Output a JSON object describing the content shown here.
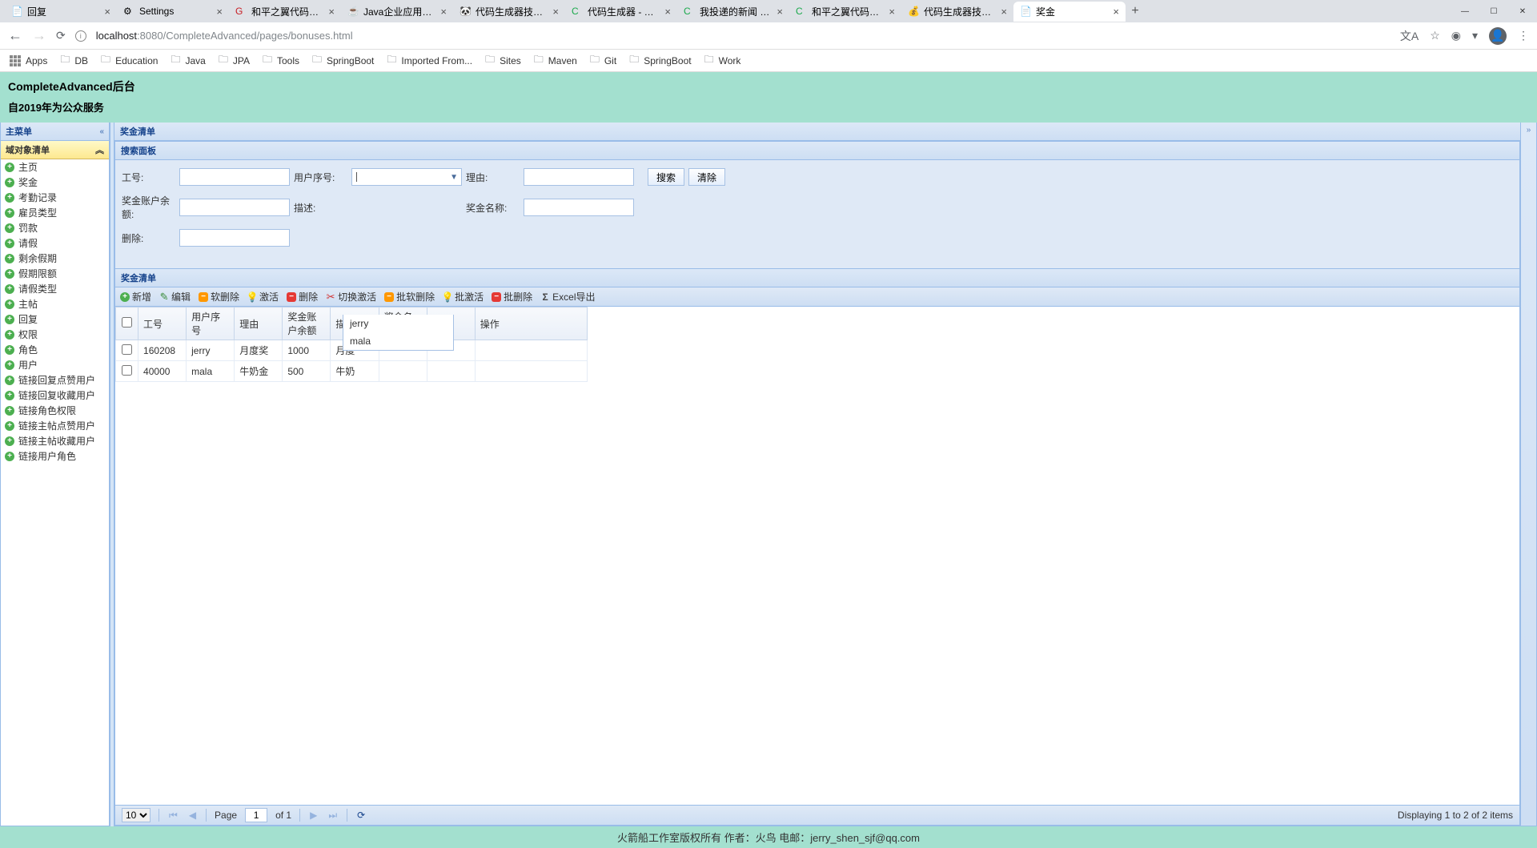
{
  "browser": {
    "tabs": [
      {
        "label": "回复"
      },
      {
        "label": "Settings"
      },
      {
        "label": "和平之翼代码生成…"
      },
      {
        "label": "Java企业应用论坛…"
      },
      {
        "label": "代码生成器技术系…"
      },
      {
        "label": "代码生成器 - MS…"
      },
      {
        "label": "我投递的新闻 - N…"
      },
      {
        "label": "和平之翼代码生成…"
      },
      {
        "label": "代码生成器技术系…"
      },
      {
        "label": "奖金"
      }
    ],
    "url_host": "localhost",
    "url_port": ":8080",
    "url_path": "/CompleteAdvanced/pages/bonuses.html",
    "bookmarks": {
      "apps": "Apps",
      "items": [
        "DB",
        "Education",
        "Java",
        "JPA",
        "Tools",
        "SpringBoot",
        "Imported From...",
        "Sites",
        "Maven",
        "Git",
        "SpringBoot",
        "Work"
      ]
    }
  },
  "header": {
    "title": "CompleteAdvanced后台",
    "subtitle": "自2019年为公众服务"
  },
  "sidebar": {
    "title": "主菜单",
    "section": "域对象清单",
    "items": [
      "主页",
      "奖金",
      "考勤记录",
      "雇员类型",
      "罚款",
      "请假",
      "剩余假期",
      "假期限额",
      "请假类型",
      "主帖",
      "回复",
      "权限",
      "角色",
      "用户",
      "链接回复点赞用户",
      "链接回复收藏用户",
      "链接角色权限",
      "链接主帖点赞用户",
      "链接主帖收藏用户",
      "链接用户角色"
    ]
  },
  "main": {
    "panel_title": "奖金清单",
    "search": {
      "title": "搜索面板",
      "labels": {
        "gh": "工号:",
        "yhxh": "用户序号:",
        "ly": "理由:",
        "jjzhye": "奖金账户余额:",
        "ms": "描述:",
        "jjmc": "奖金名称:",
        "sc": "删除:"
      },
      "btn_search": "搜索",
      "btn_clear": "清除",
      "dropdown": [
        "jerry",
        "mala"
      ]
    },
    "grid": {
      "title": "奖金清单",
      "toolbar": {
        "add": "新增",
        "edit": "编辑",
        "softdel": "软删除",
        "activate": "激活",
        "del": "删除",
        "toggleactive": "切换激活",
        "batchsoftdel": "批软删除",
        "batchactivate": "批激活",
        "batchdel": "批删除",
        "export": "Excel导出"
      },
      "cols": {
        "gh": "工号",
        "yhxh": "用户序号",
        "ly": "理由",
        "jjzhye": "奖金账户余额",
        "ms": "描述",
        "jjmc": "奖金名称",
        "sc": "删除",
        "cz": "操作"
      },
      "rows": [
        {
          "gh": "160208",
          "yhxh": "jerry",
          "ly": "月度奖",
          "jjzhye": "1000",
          "ms": "月度",
          "jjmc": "",
          "sc": ""
        },
        {
          "gh": "40000",
          "yhxh": "mala",
          "ly": "牛奶金",
          "jjzhye": "500",
          "ms": "牛奶",
          "jjmc": "",
          "sc": ""
        }
      ]
    },
    "paging": {
      "pagesize": "10",
      "page_label": "Page",
      "page_val": "1",
      "of": "of 1",
      "info": "Displaying 1 to 2 of 2 items"
    }
  },
  "footer": {
    "text": "火箭船工作室版权所有 作者：火鸟 电邮：jerry_shen_sjf@qq.com"
  }
}
